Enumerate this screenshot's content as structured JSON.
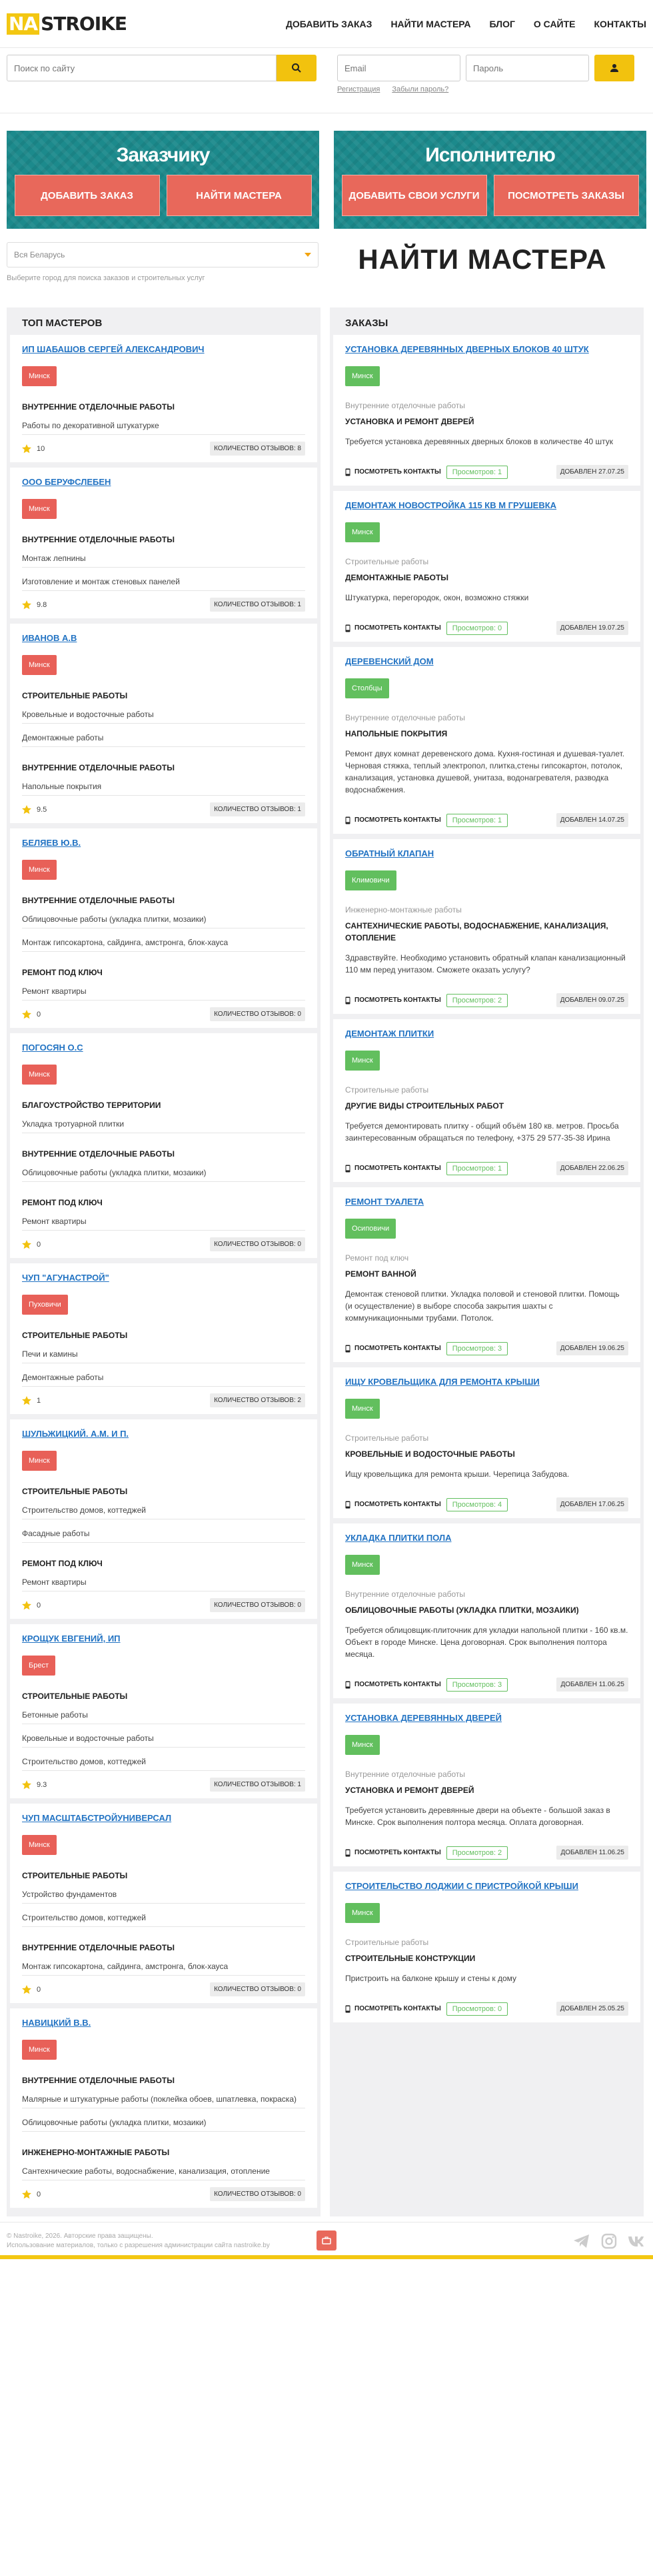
{
  "logo": {
    "prefix": "NA",
    "name": "STROIKE"
  },
  "nav": [
    "ДОБАВИТЬ ЗАКАЗ",
    "НАЙТИ МАСТЕРА",
    "БЛОГ",
    "О САЙТЕ",
    "КОНТАКТЫ"
  ],
  "search": {
    "placeholder": "Поиск по сайту"
  },
  "login": {
    "email_placeholder": "Email",
    "password_placeholder": "Пароль",
    "register": "Регистрация",
    "forgot": "Забыли пароль?"
  },
  "banners": [
    {
      "title": "Заказчику",
      "buttons": [
        "ДОБАВИТЬ ЗАКАЗ",
        "НАЙТИ МАСТЕРА"
      ]
    },
    {
      "title": "Исполнителю",
      "buttons": [
        "ДОБАВИТЬ СВОИ УСЛУГИ",
        "ПОСМОТРЕТЬ ЗАКАЗЫ"
      ]
    }
  ],
  "city_select": {
    "value": "Вся Беларусь",
    "hint": "Выберите город для поиска заказов и строительных услуг"
  },
  "page_title": "НАЙТИ МАСТЕРА",
  "masters_heading": "ТОП МАСТЕРОВ",
  "orders_heading": "ЗАКАЗЫ",
  "masters": [
    {
      "name": "ИП ШАБАШОВ СЕРГЕЙ АЛЕКСАНДРОВИЧ",
      "city": "Минск",
      "rating": "10",
      "reviews": "КОЛИЧЕСТВО ОТЗЫВОВ: 8",
      "groups": [
        {
          "cat": "ВНУТРЕННИЕ ОТДЕЛОЧНЫЕ РАБОТЫ",
          "items": [
            "Работы по декоративной штукатурке"
          ]
        }
      ]
    },
    {
      "name": "ООО БЕРУФСЛЕБЕН",
      "city": "Минск",
      "rating": "9.8",
      "reviews": "КОЛИЧЕСТВО ОТЗЫВОВ: 1",
      "groups": [
        {
          "cat": "ВНУТРЕННИЕ ОТДЕЛОЧНЫЕ РАБОТЫ",
          "items": [
            "Монтаж лепнины",
            "Изготовление и монтаж стеновых панелей"
          ]
        }
      ]
    },
    {
      "name": "ИВАНОВ А.В",
      "city": "Минск",
      "rating": "9.5",
      "reviews": "КОЛИЧЕСТВО ОТЗЫВОВ: 1",
      "groups": [
        {
          "cat": "СТРОИТЕЛЬНЫЕ РАБОТЫ",
          "items": [
            "Кровельные и водосточные работы",
            "Демонтажные работы"
          ]
        },
        {
          "cat": "ВНУТРЕННИЕ ОТДЕЛОЧНЫЕ РАБОТЫ",
          "items": [
            "Напольные покрытия"
          ]
        }
      ]
    },
    {
      "name": "БЕЛЯЕВ Ю.В.",
      "city": "Минск",
      "rating": "0",
      "reviews": "КОЛИЧЕСТВО ОТЗЫВОВ: 0",
      "groups": [
        {
          "cat": "ВНУТРЕННИЕ ОТДЕЛОЧНЫЕ РАБОТЫ",
          "items": [
            "Облицовочные работы (укладка плитки, мозаики)",
            "Монтаж гипсокартона, сайдинга, амстронга, блок-хауса"
          ]
        },
        {
          "cat": "РЕМОНТ ПОД КЛЮЧ",
          "items": [
            "Ремонт квартиры"
          ]
        }
      ]
    },
    {
      "name": "ПОГОСЯН О.С",
      "city": "Минск",
      "rating": "0",
      "reviews": "КОЛИЧЕСТВО ОТЗЫВОВ: 0",
      "groups": [
        {
          "cat": "БЛАГОУСТРОЙСТВО ТЕРРИТОРИИ",
          "items": [
            "Укладка тротуарной плитки"
          ]
        },
        {
          "cat": "ВНУТРЕННИЕ ОТДЕЛОЧНЫЕ РАБОТЫ",
          "items": [
            "Облицовочные работы (укладка плитки, мозаики)"
          ]
        },
        {
          "cat": "РЕМОНТ ПОД КЛЮЧ",
          "items": [
            "Ремонт квартиры"
          ]
        }
      ]
    },
    {
      "name": "ЧУП \"АГУНАСТРОЙ\"",
      "city": "Пуховичи",
      "rating": "1",
      "reviews": "КОЛИЧЕСТВО ОТЗЫВОВ: 2",
      "groups": [
        {
          "cat": "СТРОИТЕЛЬНЫЕ РАБОТЫ",
          "items": [
            "Печи и камины",
            "Демонтажные работы"
          ]
        }
      ]
    },
    {
      "name": "ШУЛЬЖИЦКИЙ. А.М. И П.",
      "city": "Минск",
      "rating": "0",
      "reviews": "КОЛИЧЕСТВО ОТЗЫВОВ: 0",
      "groups": [
        {
          "cat": "СТРОИТЕЛЬНЫЕ РАБОТЫ",
          "items": [
            "Строительство домов, коттеджей",
            "Фасадные работы"
          ]
        },
        {
          "cat": "РЕМОНТ ПОД КЛЮЧ",
          "items": [
            "Ремонт квартиры"
          ]
        }
      ]
    },
    {
      "name": "КРОЩУК ЕВГЕНИЙ, ИП",
      "city": "Брест",
      "rating": "9.3",
      "reviews": "КОЛИЧЕСТВО ОТЗЫВОВ: 1",
      "groups": [
        {
          "cat": "СТРОИТЕЛЬНЫЕ РАБОТЫ",
          "items": [
            "Бетонные работы",
            "Кровельные и водосточные работы",
            "Строительство домов, коттеджей"
          ]
        }
      ]
    },
    {
      "name": "ЧУП МАСШТАБСТРОЙУНИВЕРСАЛ",
      "city": "Минск",
      "rating": "0",
      "reviews": "КОЛИЧЕСТВО ОТЗЫВОВ: 0",
      "groups": [
        {
          "cat": "СТРОИТЕЛЬНЫЕ РАБОТЫ",
          "items": [
            "Устройство фундаментов",
            "Строительство домов, коттеджей"
          ]
        },
        {
          "cat": "ВНУТРЕННИЕ ОТДЕЛОЧНЫЕ РАБОТЫ",
          "items": [
            "Монтаж гипсокартона, сайдинга, амстронга, блок-хауса"
          ]
        }
      ]
    },
    {
      "name": "НАВИЦКИЙ В.В.",
      "city": "Минск",
      "rating": "0",
      "reviews": "КОЛИЧЕСТВО ОТЗЫВОВ: 0",
      "groups": [
        {
          "cat": "ВНУТРЕННИЕ ОТДЕЛОЧНЫЕ РАБОТЫ",
          "items": [
            "Малярные и штукатурные работы (поклейка обоев, шпатлевка, покраска)",
            "Облицовочные работы (укладка плитки, мозаики)"
          ]
        },
        {
          "cat": "ИНЖЕНЕРНО-МОНТАЖНЫЕ РАБОТЫ",
          "items": [
            "Сантехнические работы, водоснабжение, канализация, отопление"
          ]
        }
      ]
    }
  ],
  "orders": [
    {
      "title": "УСТАНОВКА ДЕРЕВЯННЫХ ДВЕРНЫХ БЛОКОВ 40 ШТУК",
      "city": "Минск",
      "category": "Внутренние отделочные работы",
      "subcategory": "УСТАНОВКА И РЕМОНТ ДВЕРЕЙ",
      "description": "Требуется установка деревянных дверных блоков в количестве 40 штук",
      "contacts": "ПОСМОТРЕТЬ КОНТАКТЫ",
      "views": "Просмотров: 1",
      "added": "ДОБАВЛЕН 27.07.25"
    },
    {
      "title": "ДЕМОНТАЖ НОВОСТРОЙКА 115 КВ М ГРУШЕВКА",
      "city": "Минск",
      "category": "Строительные работы",
      "subcategory": "ДЕМОНТАЖНЫЕ РАБОТЫ",
      "description": "Штукатурка, перегородок, окон, возможно стяжки",
      "contacts": "ПОСМОТРЕТЬ КОНТАКТЫ",
      "views": "Просмотров: 0",
      "added": "ДОБАВЛЕН 19.07.25"
    },
    {
      "title": "ДЕРЕВЕНСКИЙ ДОМ",
      "city": "Столбцы",
      "category": "Внутренние отделочные работы",
      "subcategory": "НАПОЛЬНЫЕ ПОКРЫТИЯ",
      "description": "Ремонт двух комнат деревенского дома. Кухня-гостиная и душевая-туалет. Черновая стяжка, теплый электропол, плитка,стены гипсокартон, потолок, канализация, установка душевой, унитаза, водонагревателя, разводка водоснабжения.",
      "contacts": "ПОСМОТРЕТЬ КОНТАКТЫ",
      "views": "Просмотров: 1",
      "added": "ДОБАВЛЕН 14.07.25"
    },
    {
      "title": "ОБРАТНЫЙ КЛАПАН",
      "city": "Климовичи",
      "category": "Инженерно-монтажные работы",
      "subcategory": "САНТЕХНИЧЕСКИЕ РАБОТЫ, ВОДОСНАБЖЕНИЕ, КАНАЛИЗАЦИЯ, ОТОПЛЕНИЕ",
      "description": "Здравствуйте. Необходимо установить обратный клапан канализационный 110 мм перед унитазом. Сможете оказать услугу?",
      "contacts": "ПОСМОТРЕТЬ КОНТАКТЫ",
      "views": "Просмотров: 2",
      "added": "ДОБАВЛЕН 09.07.25"
    },
    {
      "title": "ДЕМОНТАЖ ПЛИТКИ",
      "city": "Минск",
      "category": "Строительные работы",
      "subcategory": "ДРУГИЕ ВИДЫ СТРОИТЕЛЬНЫХ РАБОТ",
      "description": "Требуется демонтировать плитку - общий объём 180 кв. метров. Просьба заинтересованным обращаться по телефону, +375 29 577-35-38 Ирина",
      "contacts": "ПОСМОТРЕТЬ КОНТАКТЫ",
      "views": "Просмотров: 1",
      "added": "ДОБАВЛЕН 22.06.25"
    },
    {
      "title": "РЕМОНТ ТУАЛЕТА",
      "city": "Осиповичи",
      "category": "Ремонт под ключ",
      "subcategory": "РЕМОНТ ВАННОЙ",
      "description": "Демонтаж стеновой плитки. Укладка половой и стеновой плитки. Помощь (и осуществление) в выборе способа закрытия шахты с коммуникационными трубами. Потолок.",
      "contacts": "ПОСМОТРЕТЬ КОНТАКТЫ",
      "views": "Просмотров: 3",
      "added": "ДОБАВЛЕН 19.06.25"
    },
    {
      "title": "ИЩУ КРОВЕЛЬЩИКА ДЛЯ РЕМОНТА КРЫШИ",
      "city": "Минск",
      "category": "Строительные работы",
      "subcategory": "КРОВЕЛЬНЫЕ И ВОДОСТОЧНЫЕ РАБОТЫ",
      "description": "Ищу кровельщика для ремонта крыши. Черепица Забудова.",
      "contacts": "ПОСМОТРЕТЬ КОНТАКТЫ",
      "views": "Просмотров: 4",
      "added": "ДОБАВЛЕН 17.06.25"
    },
    {
      "title": "УКЛАДКА ПЛИТКИ ПОЛА",
      "city": "Минск",
      "category": "Внутренние отделочные работы",
      "subcategory": "ОБЛИЦОВОЧНЫЕ РАБОТЫ (УКЛАДКА ПЛИТКИ, МОЗАИКИ)",
      "description": "Требуется облицовщик-плиточник для укладки напольной плитки - 160 кв.м. Объект в городе Минске. Цена договорная. Срок выполнения полтора месяца.",
      "contacts": "ПОСМОТРЕТЬ КОНТАКТЫ",
      "views": "Просмотров: 3",
      "added": "ДОБАВЛЕН 11.06.25"
    },
    {
      "title": "УСТАНОВКА ДЕРЕВЯННЫХ ДВЕРЕЙ",
      "city": "Минск",
      "category": "Внутренние отделочные работы",
      "subcategory": "УСТАНОВКА И РЕМОНТ ДВЕРЕЙ",
      "description": "Требуется установить деревянные двери на объекте - большой заказ в Минске. Срок выполнения полтора месяца. Оплата договорная.",
      "contacts": "ПОСМОТРЕТЬ КОНТАКТЫ",
      "views": "Просмотров: 2",
      "added": "ДОБАВЛЕН 11.06.25"
    },
    {
      "title": "СТРОИТЕЛЬСТВО ЛОДЖИИ С ПРИСТРОЙКОЙ КРЫШИ",
      "city": "Минск",
      "category": "Строительные работы",
      "subcategory": "СТРОИТЕЛЬНЫЕ КОНСТРУКЦИИ",
      "description": "Пристроить на балконе крышу и стены к дому",
      "contacts": "ПОСМОТРЕТЬ КОНТАКТЫ",
      "views": "Просмотров: 0",
      "added": "ДОБАВЛЕН 25.05.25"
    }
  ],
  "footer": {
    "copyright": "© Nastroike, 2026. Авторские права защищены.",
    "notice": "Использование материалов, только с разрешения администрации сайта nastroike.by"
  },
  "colors": {
    "accent": "#f2c20e",
    "banner": "#1c8a8c",
    "button": "#e8685b",
    "city_red": "#e86058",
    "city_green": "#62bf5e",
    "link": "#2273c3"
  }
}
